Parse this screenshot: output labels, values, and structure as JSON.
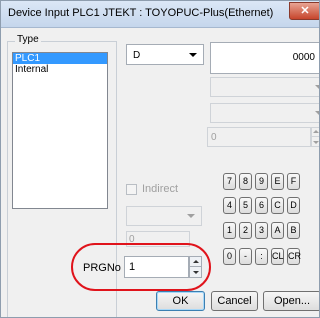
{
  "window": {
    "title": "Device Input  PLC1 JTEKT : TOYOPUC-Plus(Ethernet)",
    "close_glyph": "✕"
  },
  "type_group": {
    "label": "Type",
    "items": [
      "PLC1",
      "Internal"
    ],
    "selected_index": 0
  },
  "device_select": {
    "value": "D"
  },
  "address_field": {
    "value": "0000"
  },
  "numeric_field": {
    "value": "0"
  },
  "numeric_field2": {
    "value": "0"
  },
  "indirect": {
    "label": "Indirect",
    "checked": false
  },
  "keypad": {
    "rows": [
      [
        "7",
        "8",
        "9",
        "E",
        "F"
      ],
      [
        "4",
        "5",
        "6",
        "C",
        "D"
      ],
      [
        "1",
        "2",
        "3",
        "A",
        "B"
      ],
      [
        "0",
        "-",
        ":",
        "CL",
        "CR"
      ]
    ]
  },
  "prgno": {
    "label": "PRGNo",
    "value": "1"
  },
  "buttons": {
    "ok": "OK",
    "cancel": "Cancel",
    "open": "Open..."
  },
  "colors": {
    "highlight_oval": "#e0131b",
    "selection": "#3399ff"
  }
}
